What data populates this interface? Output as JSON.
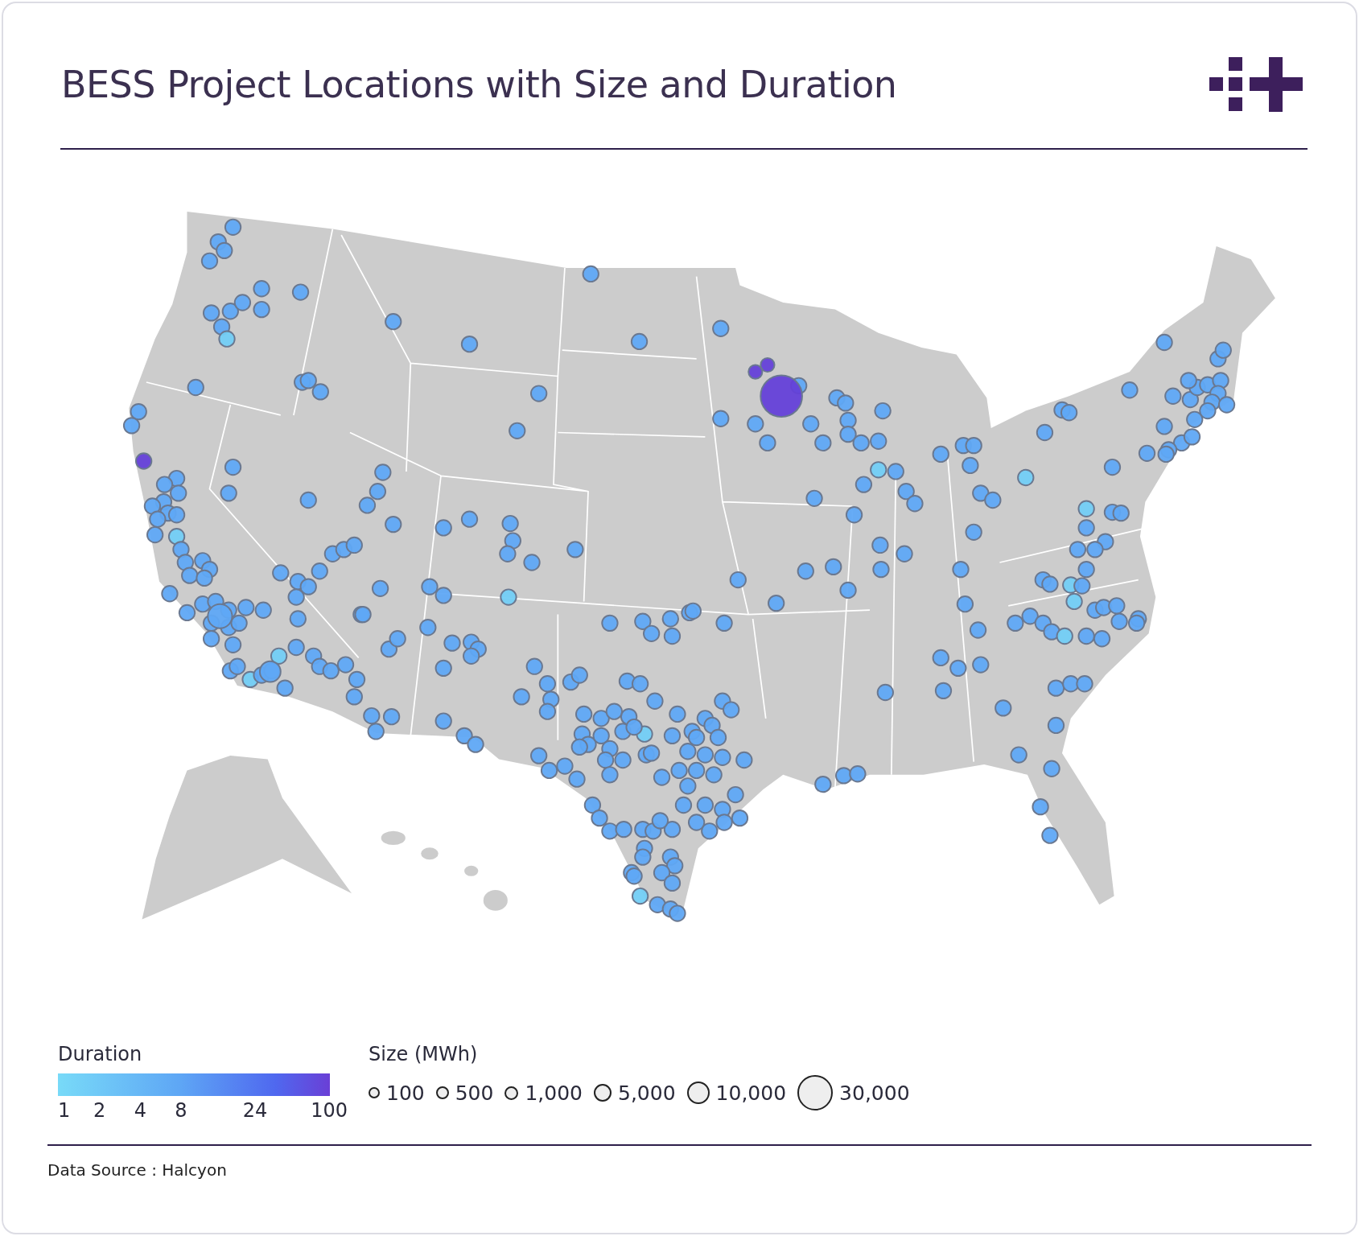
{
  "header": {
    "title": "BESS Project Locations with Size and Duration"
  },
  "legend": {
    "duration": {
      "title": "Duration",
      "ticks": [
        "1",
        "2",
        "4",
        "8",
        "24",
        "100"
      ]
    },
    "size": {
      "title": "Size (MWh)",
      "items": [
        {
          "label": "100"
        },
        {
          "label": "500"
        },
        {
          "label": "1,000"
        },
        {
          "label": "5,000"
        },
        {
          "label": "10,000"
        },
        {
          "label": "30,000"
        }
      ]
    }
  },
  "footer": {
    "source": "Data Source : Halcyon"
  }
}
